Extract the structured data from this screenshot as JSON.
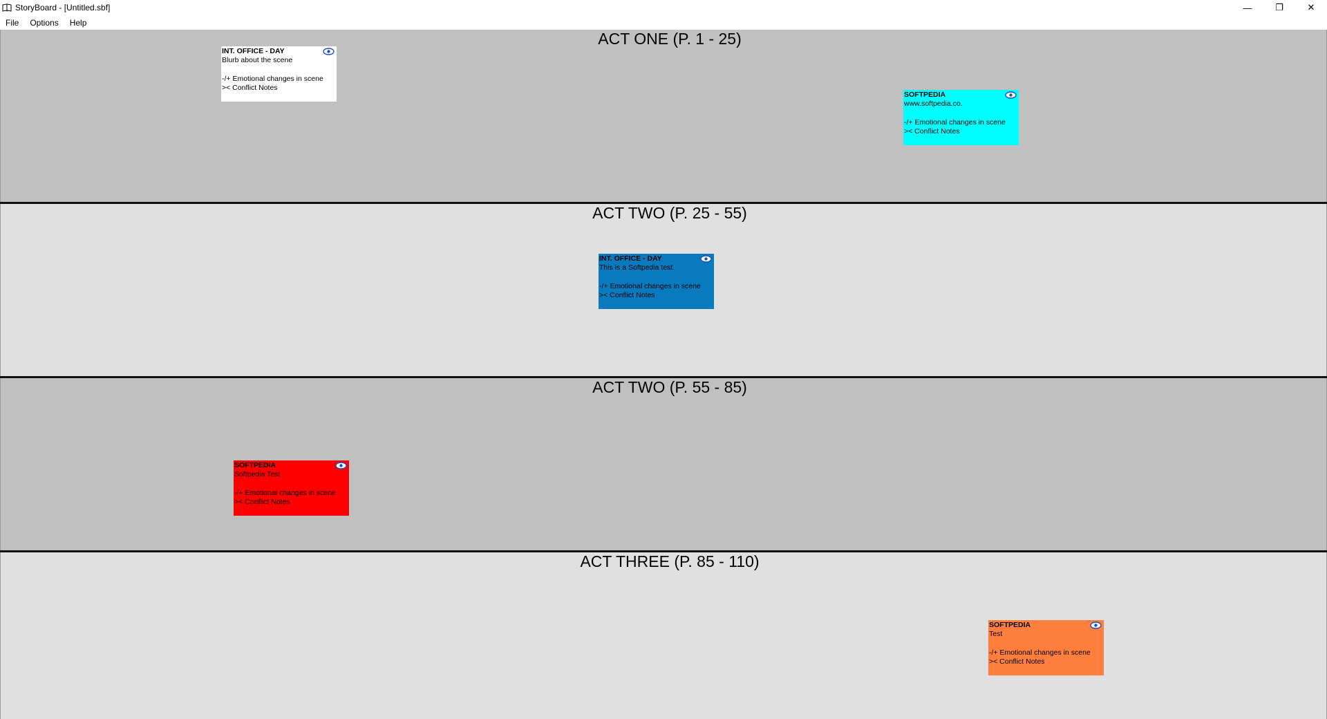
{
  "window": {
    "title": "StoryBoard - [Untitled.sbf]",
    "app_icon": "book-icon",
    "controls": {
      "minimize": "—",
      "restore": "❐",
      "close": "✕"
    }
  },
  "menu": [
    "File",
    "Options",
    "Help"
  ],
  "acts": [
    {
      "title": "ACT ONE (P. 1 - 25)",
      "shade": "dark"
    },
    {
      "title": "ACT TWO (P. 25 - 55)",
      "shade": "light"
    },
    {
      "title": "ACT TWO (P. 55 - 85)",
      "shade": "dark"
    },
    {
      "title": "ACT THREE (P. 85 - 110)",
      "shade": "light"
    }
  ],
  "cards": [
    {
      "heading": "INT. OFFICE - DAY",
      "body": "Blurb about the scene",
      "emotion": "-/+ Emotional changes in scene",
      "conflict": ">< Conflict Notes",
      "color": "#ffffff",
      "icon": "eye-icon"
    },
    {
      "heading": "SOFTPEDIA",
      "body": "www.softpedia.co.",
      "emotion": "-/+ Emotional changes in scene",
      "conflict": ">< Conflict Notes",
      "color": "#00ffff",
      "icon": "eye-icon"
    },
    {
      "heading": "INT. OFFICE - DAY",
      "body": "This is a Softpedia test.",
      "emotion": "-/+ Emotional changes in scene",
      "conflict": ">< Conflict Notes",
      "color": "#0a7abf",
      "icon": "eye-icon"
    },
    {
      "heading": "SOFTPEDIA",
      "body": "Softpedia Test",
      "emotion": "-/+ Emotional changes in scene",
      "conflict": ">< Conflict Notes",
      "color": "#ff0000",
      "icon": "eye-icon"
    },
    {
      "heading": "SOFTPEDIA",
      "body": "Test",
      "emotion": "-/+ Emotional changes in scene",
      "conflict": ">< Conflict Notes",
      "color": "#ff7f3f",
      "icon": "eye-icon"
    }
  ]
}
